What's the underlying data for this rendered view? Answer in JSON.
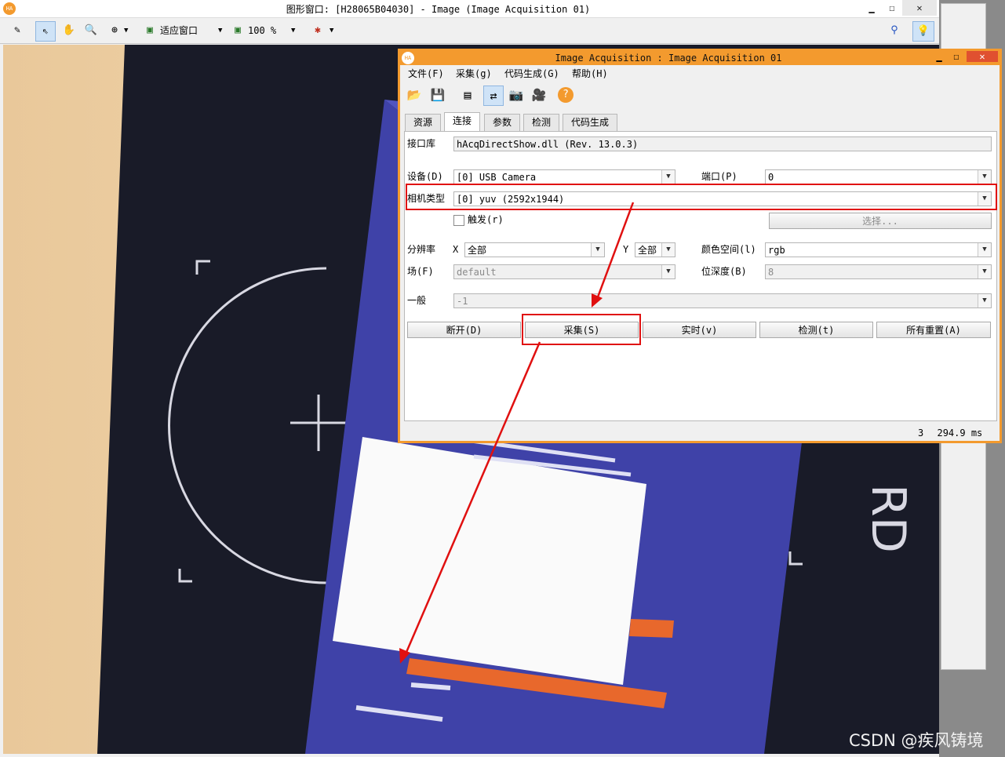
{
  "graphics_window": {
    "title": "图形窗口: [H28065B04030] - Image (Image Acquisition 01)",
    "minimize": "▁",
    "maximize": "☐",
    "close": "✕",
    "toolbar": {
      "fit_window_label": "适应窗口",
      "zoom_label": "100 %"
    }
  },
  "acq_dialog": {
    "title": "Image Acquisition : Image Acquisition 01",
    "menu": [
      "文件(F)",
      "采集(g)",
      "代码生成(G)",
      "帮助(H)"
    ],
    "tabs": [
      "资源",
      "连接",
      "参数",
      "检测",
      "代码生成"
    ],
    "active_tab": "连接",
    "interface_label": "接口库",
    "interface_value": "hAcqDirectShow.dll (Rev. 13.0.3)",
    "device_label": "设备(D)",
    "device_value": "[0] USB Camera",
    "port_label": "端口(P)",
    "port_value": "0",
    "camera_type_label": "相机类型",
    "camera_type_value": "[0] yuv (2592x1944)",
    "trigger_label": "触发(r)",
    "select_button": "选择...",
    "resolution_label": "分辨率",
    "x_label": "X",
    "x_value": "全部",
    "y_label": "Y",
    "y_value": "全部",
    "color_space_label": "颜色空间(l)",
    "color_space_value": "rgb",
    "field_label": "场(F)",
    "field_value": "default",
    "bit_depth_label": "位深度(B)",
    "bit_depth_value": "8",
    "general_label": "一般",
    "general_value": "-1",
    "buttons": {
      "disconnect": "断开(D)",
      "acquire": "采集(S)",
      "live": "实时(v)",
      "detect": "检测(t)",
      "reset_all": "所有重置(A)"
    },
    "status_count": "3",
    "status_time": "294.9 ms"
  },
  "watermark": "CSDN @疾风铸境",
  "colors": {
    "accent_orange": "#f39a2e",
    "annotation_red": "#e01010"
  }
}
